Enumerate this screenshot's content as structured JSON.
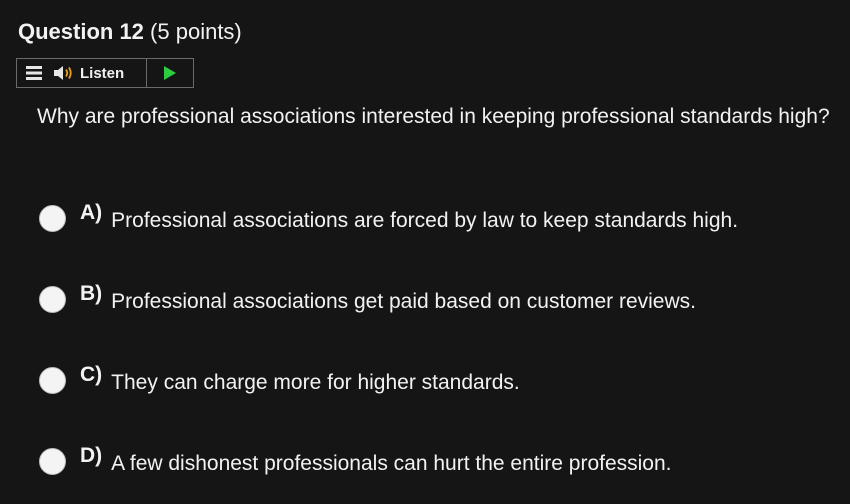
{
  "question": {
    "title": "Question 12",
    "points": "(5 points)",
    "text": "Why are professional associations interested in keeping professional standards high?"
  },
  "toolbar": {
    "menu_icon": "menu-icon",
    "speaker_icon": "speaker-icon",
    "listen_label": "Listen",
    "play_icon": "play-icon",
    "play_color": "#2ecc40"
  },
  "options": [
    {
      "letter": "A)",
      "text": "Professional associations are forced by law to keep standards high."
    },
    {
      "letter": "B)",
      "text": "Professional associations get paid based on customer reviews."
    },
    {
      "letter": "C)",
      "text": "They can charge more for higher standards."
    },
    {
      "letter": "D)",
      "text": "A few dishonest professionals can hurt the entire profession."
    }
  ]
}
